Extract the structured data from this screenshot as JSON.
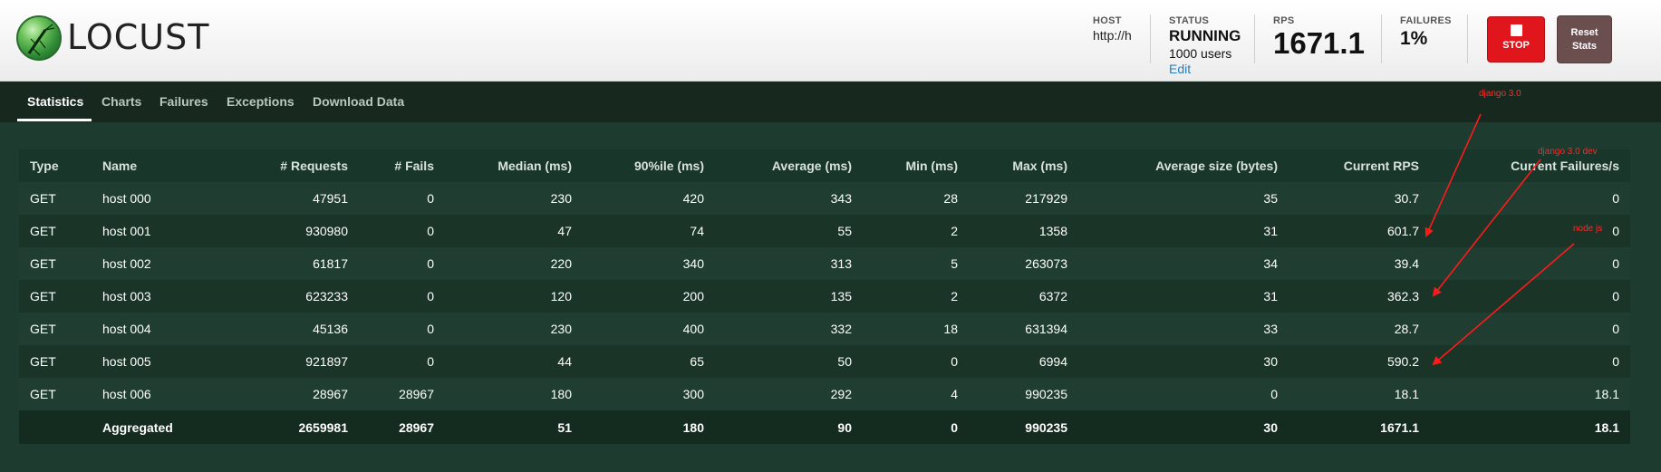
{
  "app": {
    "name": "LOCUST"
  },
  "header": {
    "host": {
      "label": "HOST",
      "value": "http://h"
    },
    "status": {
      "label": "STATUS",
      "value": "RUNNING",
      "users": "1000 users",
      "edit_label": "Edit"
    },
    "rps": {
      "label": "RPS",
      "value": "1671.1"
    },
    "failures": {
      "label": "FAILURES",
      "value": "1%"
    },
    "stop_label": "STOP",
    "reset_label_line1": "Reset",
    "reset_label_line2": "Stats"
  },
  "tabs": [
    {
      "label": "Statistics",
      "active": true
    },
    {
      "label": "Charts",
      "active": false
    },
    {
      "label": "Failures",
      "active": false
    },
    {
      "label": "Exceptions",
      "active": false
    },
    {
      "label": "Download Data",
      "active": false
    }
  ],
  "table": {
    "columns": [
      "Type",
      "Name",
      "# Requests",
      "# Fails",
      "Median (ms)",
      "90%ile (ms)",
      "Average (ms)",
      "Min (ms)",
      "Max (ms)",
      "Average size (bytes)",
      "Current RPS",
      "Current Failures/s"
    ],
    "rows": [
      [
        "GET",
        "host 000",
        "47951",
        "0",
        "230",
        "420",
        "343",
        "28",
        "217929",
        "35",
        "30.7",
        "0"
      ],
      [
        "GET",
        "host 001",
        "930980",
        "0",
        "47",
        "74",
        "55",
        "2",
        "1358",
        "31",
        "601.7",
        "0"
      ],
      [
        "GET",
        "host 002",
        "61817",
        "0",
        "220",
        "340",
        "313",
        "5",
        "263073",
        "34",
        "39.4",
        "0"
      ],
      [
        "GET",
        "host 003",
        "623233",
        "0",
        "120",
        "200",
        "135",
        "2",
        "6372",
        "31",
        "362.3",
        "0"
      ],
      [
        "GET",
        "host 004",
        "45136",
        "0",
        "230",
        "400",
        "332",
        "18",
        "631394",
        "33",
        "28.7",
        "0"
      ],
      [
        "GET",
        "host 005",
        "921897",
        "0",
        "44",
        "65",
        "50",
        "0",
        "6994",
        "30",
        "590.2",
        "0"
      ],
      [
        "GET",
        "host 006",
        "28967",
        "28967",
        "180",
        "300",
        "292",
        "4",
        "990235",
        "0",
        "18.1",
        "18.1"
      ]
    ],
    "aggregated": [
      "",
      "Aggregated",
      "2659981",
      "28967",
      "51",
      "180",
      "90",
      "0",
      "990235",
      "30",
      "1671.1",
      "18.1"
    ]
  },
  "annotations": [
    {
      "text": "django 3.0"
    },
    {
      "text": "django 3.0 dev"
    },
    {
      "text": "node js"
    }
  ],
  "colors": {
    "annotation": "#ff2a2a",
    "stop_button": "#e0161c",
    "reset_button": "#6b4f4f",
    "background": "#1d3b2f"
  },
  "icons": {
    "logo": "locust-logo-icon",
    "stop": "stop-square-icon"
  }
}
